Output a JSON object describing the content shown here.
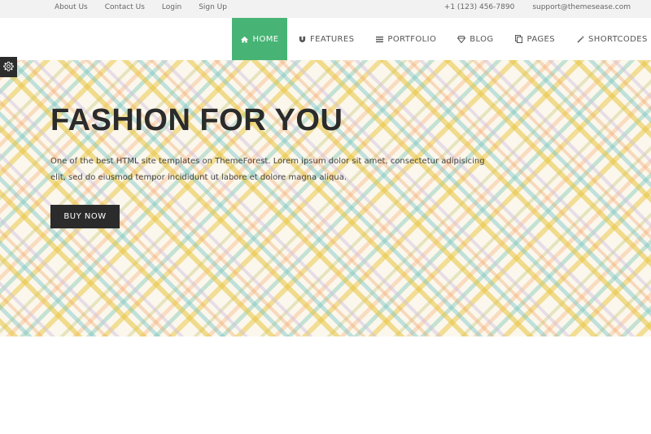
{
  "topbar": {
    "links": [
      "About Us",
      "Contact Us",
      "Login",
      "Sign Up"
    ],
    "phone": "+1 (123) 456-7890",
    "email": "support@themesease.com"
  },
  "nav": {
    "items": [
      {
        "label": "HOME",
        "icon": "home-icon",
        "active": true
      },
      {
        "label": "FEATURES",
        "icon": "magnet-icon"
      },
      {
        "label": "PORTFOLIO",
        "icon": "list-icon"
      },
      {
        "label": "BLOG",
        "icon": "diamond-icon"
      },
      {
        "label": "PAGES",
        "icon": "copy-icon"
      },
      {
        "label": "SHORTCODES",
        "icon": "magic-wand-icon"
      }
    ],
    "accent": "#47b475"
  },
  "hero": {
    "title": "FASHION FOR YOU",
    "description": "One of the best HTML site templates on ThemeForest. Lorem ipsum dolor sit amet, consectetur adipisicing elit, sed do eiusmod tempor incididunt ut labore et dolore magna aliqua.",
    "button": "BUY NOW"
  },
  "settings": {
    "icon": "gear-icon"
  }
}
